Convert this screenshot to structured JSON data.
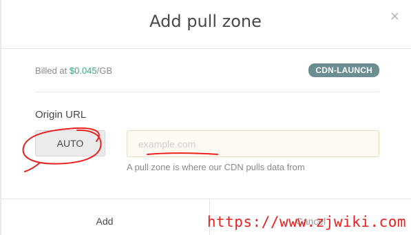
{
  "dialog": {
    "title": "Add pull zone",
    "close_glyph": "×"
  },
  "billing": {
    "prefix": "Billed at ",
    "price": "$0.045",
    "suffix": "/GB"
  },
  "badge": "CDN-LAUNCH",
  "origin": {
    "label": "Origin URL",
    "protocol": "AUTO",
    "placeholder": "example.com",
    "value": "",
    "help": "A pull zone is where our CDN pulls data from"
  },
  "footer": {
    "add_label": "Add",
    "cancel_label": "Cancel"
  },
  "watermark": "https://www.zjwiki.com",
  "colors": {
    "accent_green": "#3aa57e",
    "badge_bg": "#6c8e91",
    "input_bg": "#fefaf2",
    "annotation_red": "#e8201e"
  }
}
